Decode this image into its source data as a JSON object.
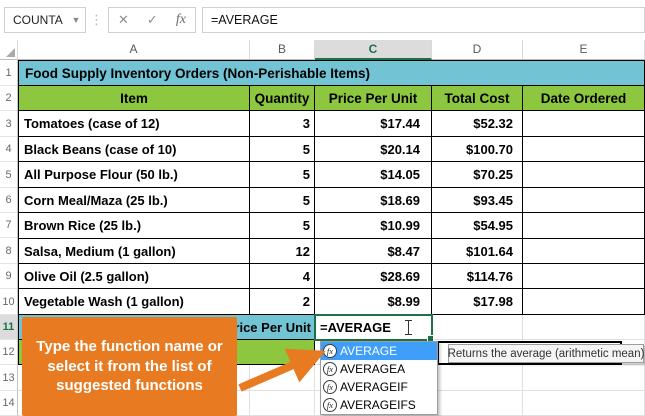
{
  "formula_bar": {
    "name_box_value": "COUNTA",
    "formula_value": "=AVERAGE",
    "icons": {
      "dropdown_arrow": "▼",
      "cancel": "✕",
      "enter": "✓",
      "insert_function": "fx",
      "separator_dots": "⋮"
    }
  },
  "sheet": {
    "columns": [
      "A",
      "B",
      "C",
      "D",
      "E"
    ],
    "selected_column": "C",
    "row_numbers": [
      "1",
      "2",
      "3",
      "4",
      "5",
      "6",
      "7",
      "8",
      "9",
      "10",
      "11",
      "12",
      "13",
      "14"
    ],
    "selected_row": "11",
    "title": "Food Supply Inventory Orders (Non-Perishable Items)",
    "headers": [
      "Item",
      "Quantity",
      "Price Per Unit",
      "Total Cost",
      "Date Ordered"
    ],
    "data_rows": [
      {
        "cells": [
          "Tomatoes (case of 12)",
          "3",
          "$17.44",
          "$52.32",
          ""
        ]
      },
      {
        "cells": [
          "Black Beans (case of 10)",
          "5",
          "$20.14",
          "$100.70",
          ""
        ]
      },
      {
        "cells": [
          "All Purpose Flour (50 lb.)",
          "5",
          "$14.05",
          "$70.25",
          ""
        ]
      },
      {
        "cells": [
          "Corn Meal/Maza (25 lb.)",
          "5",
          "$18.69",
          "$93.45",
          ""
        ]
      },
      {
        "cells": [
          "Brown Rice (25 lb.)",
          "5",
          "$10.99",
          "$54.95",
          ""
        ]
      },
      {
        "cells": [
          "Salsa, Medium (1 gallon)",
          "12",
          "$8.47",
          "$101.64",
          ""
        ]
      },
      {
        "cells": [
          "Olive Oil (2.5 gallon)",
          "4",
          "$28.69",
          "$114.76",
          ""
        ]
      },
      {
        "cells": [
          "Vegetable Wash (1 gallon)",
          "2",
          "$8.99",
          "$17.98",
          ""
        ]
      }
    ],
    "average_label": "Average Price Per Unit",
    "edit_cell_value": "=AVERAGE"
  },
  "autocomplete": {
    "items": [
      "AVERAGE",
      "AVERAGEA",
      "AVERAGEIF",
      "AVERAGEIFS"
    ],
    "selected_index": 0,
    "fx_icon_glyph": "fx",
    "tooltip": "Returns the average (arithmetic mean)"
  },
  "callout": {
    "text": "Type the function name or select it from the list of suggested functions"
  },
  "colors": {
    "title_teal": "#72c3d4",
    "header_green": "#8dc63f",
    "callout_orange": "#e87b21",
    "selection_blue": "#3e9ef9",
    "excel_green": "#1e7145"
  }
}
